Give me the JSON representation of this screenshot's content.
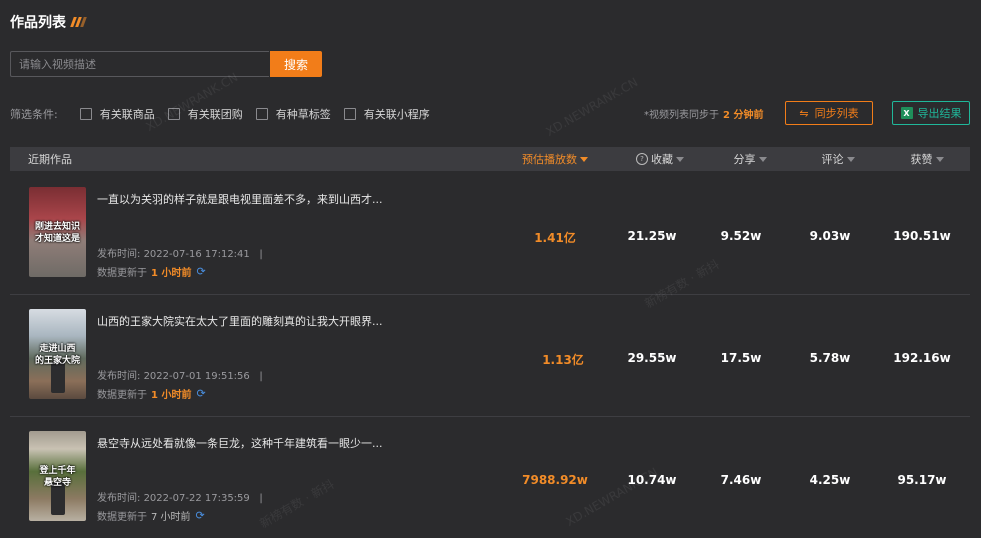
{
  "header": {
    "title": "作品列表"
  },
  "search": {
    "placeholder": "请输入视频描述",
    "button_label": "搜索"
  },
  "filters": {
    "label": "筛选条件:",
    "options": [
      "有关联商品",
      "有关联团购",
      "有种草标签",
      "有关联小程序"
    ]
  },
  "sync": {
    "note_prefix": "*视频列表同步于",
    "note_time": "2 分钟前",
    "sync_button": "同步列表",
    "export_button": "导出结果"
  },
  "table": {
    "headers": {
      "works": "近期作品",
      "plays": "预估播放数",
      "favorites": "收藏",
      "shares": "分享",
      "comments": "评论",
      "likes": "获赞"
    },
    "rows": [
      {
        "desc": "一直以为关羽的样子就是跟电视里面差不多，来到山西才...",
        "thumb_caption": "刚进去知识\n才知道这是",
        "published_label": "发布时间:",
        "published": "2022-07-16 17:12:41",
        "updated_label": "数据更新于",
        "updated": "1 小时前",
        "plays": "1.41亿",
        "favorites": "21.25w",
        "shares": "9.52w",
        "comments": "9.03w",
        "likes": "190.51w"
      },
      {
        "desc": "山西的王家大院实在太大了里面的雕刻真的让我大开眼界...",
        "thumb_caption": "走进山西\n的王家大院",
        "published_label": "发布时间:",
        "published": "2022-07-01 19:51:56",
        "updated_label": "数据更新于",
        "updated": "1 小时前",
        "plays": "1.13亿",
        "favorites": "29.55w",
        "shares": "17.5w",
        "comments": "5.78w",
        "likes": "192.16w"
      },
      {
        "desc": "悬空寺从远处看就像一条巨龙，这种千年建筑看一眼少一...",
        "thumb_caption": "登上千年\n悬空寺",
        "published_label": "发布时间:",
        "published": "2022-07-22 17:35:59",
        "updated_label": "数据更新于",
        "updated": "7 小时前",
        "plays": "7988.92w",
        "favorites": "10.74w",
        "shares": "7.46w",
        "comments": "4.25w",
        "likes": "95.17w"
      }
    ]
  },
  "watermarks": [
    "XD.NEWRANK.CN",
    "新榜有数 · 新抖"
  ],
  "colors": {
    "accent": "#f27d19",
    "export": "#20b79a",
    "background": "#2b2b2d",
    "header_bg": "#3c3c40"
  }
}
